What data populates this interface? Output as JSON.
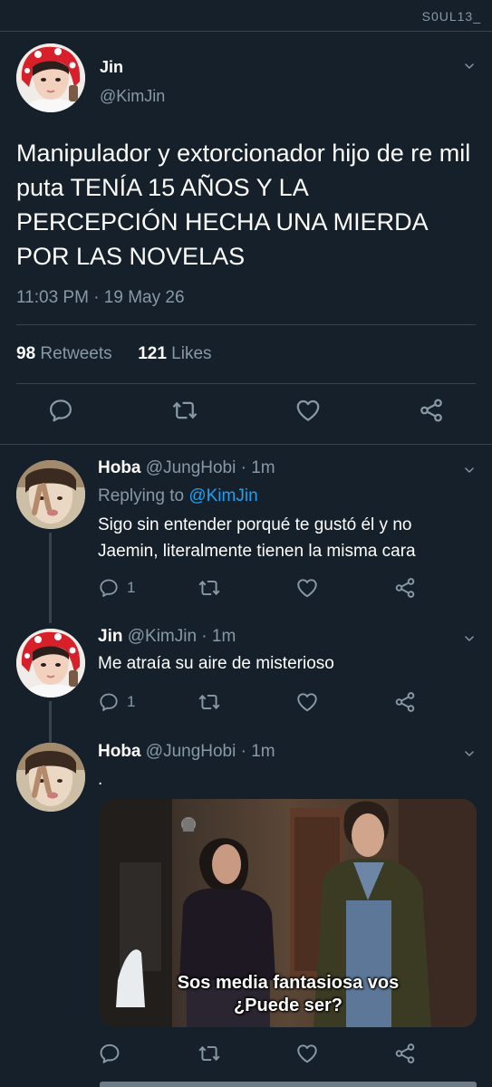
{
  "watermark": "S0UL13_",
  "main_tweet": {
    "name": "Jin",
    "handle": "@KimJin",
    "text": "Manipulador y extorcionador hijo de re mil puta TENÍA 15 AÑOS Y LA PERCEPCIÓN HECHA UNA MIERDA POR LAS NOVELAS",
    "time": "11:03 PM · 19 May 26",
    "retweets_count": "98",
    "retweets_label": "Retweets",
    "likes_count": "121",
    "likes_label": "Likes",
    "avatar_icon": "user-avatar-red-hat"
  },
  "replies": [
    {
      "name": "Hoba",
      "handle": "@JungHobi · 1m",
      "replying_prefix": "Replying to",
      "replying_to": "@KimJin",
      "text": "Sigo sin entender porqué te gustó él y no Jaemin, literalmente tienen la misma cara",
      "reply_count": "1"
    },
    {
      "name": "Jin",
      "handle": "@KimJin · 1m",
      "text": "Me atraía su aire de misterioso",
      "reply_count": "1"
    },
    {
      "name": "Hoba",
      "handle": "@JungHobi · 1m",
      "text": ".",
      "media_caption_line1": "Sos media fantasiosa vos",
      "media_caption_line2": "¿Puede ser?"
    }
  ],
  "icons": {
    "reply": "reply-icon",
    "retweet": "retweet-icon",
    "like": "heart-icon",
    "share": "share-icon",
    "more": "chevron-down-icon"
  },
  "colors": {
    "background": "#15202b",
    "divider": "#38444d",
    "secondary_text": "#8899a6",
    "link": "#1da1f2"
  }
}
